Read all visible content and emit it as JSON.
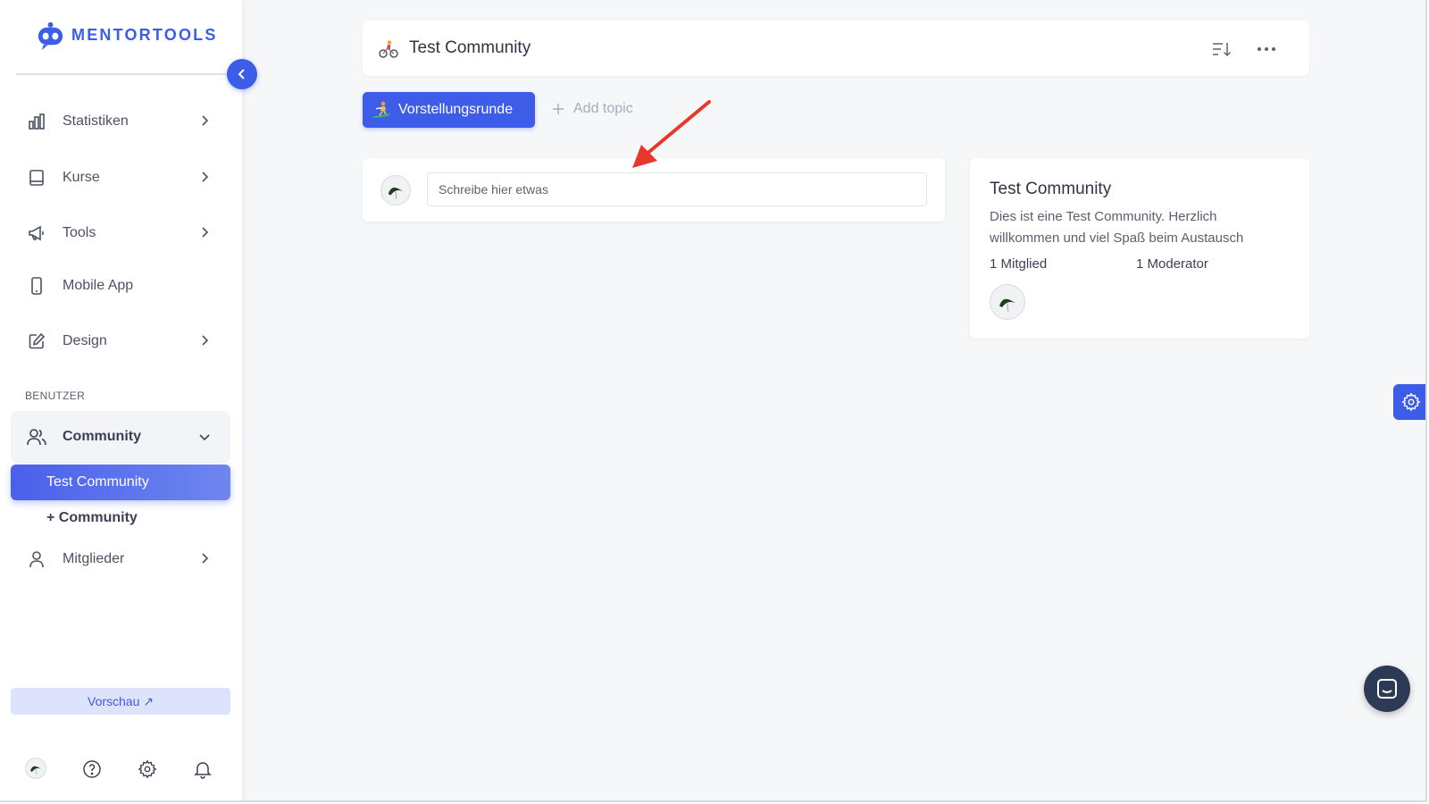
{
  "brand": {
    "name": "MENTORTOOLS",
    "color": "#3b5ee8"
  },
  "sidebar": {
    "items": [
      {
        "label": "Statistiken",
        "icon": "bar-chart-icon"
      },
      {
        "label": "Kurse",
        "icon": "book-icon"
      },
      {
        "label": "Tools",
        "icon": "megaphone-icon"
      },
      {
        "label": "Mobile App",
        "icon": "phone-icon"
      },
      {
        "label": "Design",
        "icon": "edit-icon"
      }
    ],
    "section_label": "BENUTZER",
    "community": {
      "label": "Community",
      "icon": "users-icon",
      "subitems": [
        {
          "label": "Test Community",
          "active": true
        },
        {
          "label": "+ Community"
        }
      ]
    },
    "members": {
      "label": "Mitglieder",
      "icon": "user-icon"
    },
    "preview_label": "Vorschau ↗",
    "bottom_icons": [
      "avatar",
      "help-icon",
      "gear-icon",
      "bell-icon"
    ]
  },
  "header": {
    "emoji": "cyclist",
    "title": "Test Community",
    "actions": [
      "sort-icon",
      "more-icon"
    ]
  },
  "topics": {
    "active": {
      "label": "Vorstellungsrunde",
      "emoji": "surfer"
    },
    "add_label": "Add topic"
  },
  "compose": {
    "placeholder": "Schreibe hier etwas"
  },
  "info": {
    "title": "Test Community",
    "description": "Dies ist eine Test Community. Herzlich willkommen und viel Spaß beim Austausch",
    "members": "1 Mitglied",
    "moderators": "1 Moderator"
  },
  "colors": {
    "accent": "#3d5ce8",
    "annotation_arrow": "#e8382c",
    "chat_button": "#2d3a55"
  }
}
